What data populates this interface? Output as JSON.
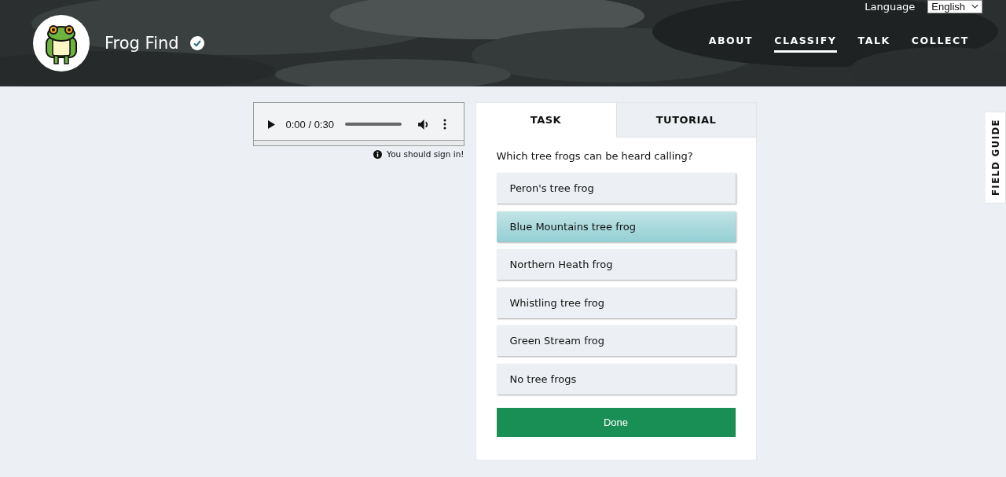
{
  "header": {
    "title": "Frog Find",
    "verified": true,
    "language_label": "Language",
    "language": "English",
    "nav": [
      {
        "label": "ABOUT",
        "selected": false
      },
      {
        "label": "CLASSIFY",
        "selected": true
      },
      {
        "label": "TALK",
        "selected": false
      },
      {
        "label": "COLLECT",
        "selected": false
      }
    ]
  },
  "player": {
    "time": "0:00 / 0:30",
    "level": 0
  },
  "notice": "You should sign in!",
  "tabs": [
    {
      "label": "TASK",
      "selected": true
    },
    {
      "label": "TUTORIAL",
      "selected": false
    }
  ],
  "question": "Which tree frogs can be heard calling?",
  "answers": [
    {
      "label": "Peron's tree frog",
      "selected": false
    },
    {
      "label": "Blue Mountains tree frog",
      "selected": true
    },
    {
      "label": "Northern Heath frog",
      "selected": false
    },
    {
      "label": "Whistling tree frog",
      "selected": false
    },
    {
      "label": "Green Stream frog",
      "selected": false
    },
    {
      "label": "No tree frogs",
      "selected": false
    }
  ],
  "done_button": "Done",
  "field_guide": "FIELD GUIDE"
}
